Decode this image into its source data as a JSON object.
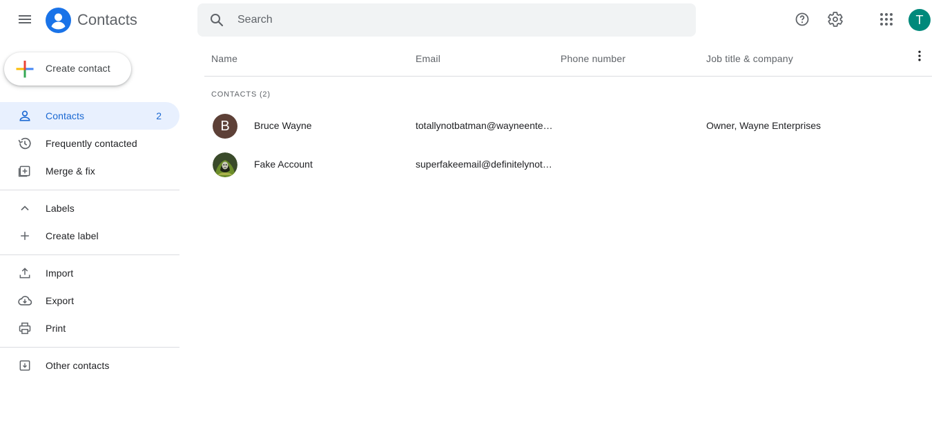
{
  "header": {
    "app_title": "Contacts",
    "search_placeholder": "Search",
    "account_initial": "T",
    "icons": [
      "menu-icon",
      "contacts-logo-icon",
      "search-icon",
      "help-icon",
      "settings-icon",
      "apps-grid-icon"
    ]
  },
  "sidebar": {
    "create_label": "Create contact",
    "items": [
      {
        "label": "Contacts",
        "count": "2",
        "icon": "person-icon",
        "active": true
      },
      {
        "label": "Frequently contacted",
        "icon": "history-icon"
      },
      {
        "label": "Merge & fix",
        "icon": "merge-icon"
      },
      {
        "label": "Labels",
        "icon": "chevron-up-icon"
      },
      {
        "label": "Create label",
        "icon": "plus-icon"
      },
      {
        "label": "Import",
        "icon": "upload-icon"
      },
      {
        "label": "Export",
        "icon": "cloud-download-icon"
      },
      {
        "label": "Print",
        "icon": "printer-icon"
      },
      {
        "label": "Other contacts",
        "icon": "archive-icon"
      }
    ]
  },
  "table": {
    "columns": [
      "Name",
      "Email",
      "Phone number",
      "Job title & company"
    ],
    "section_label": "CONTACTS (2)",
    "rows": [
      {
        "initial": "B",
        "name": "Bruce Wayne",
        "email": "totallynotbatman@wayneenterprises.com",
        "phone": "",
        "job": "Owner, Wayne Enterprises"
      },
      {
        "initial": "",
        "name": "Fake Account",
        "email": "superfakeemail@definitelynotreal.com",
        "phone": "",
        "job": ""
      }
    ]
  },
  "colors": {
    "accent": "#1a73e8",
    "active_bg": "#e8f0fe",
    "avatar_account": "#00897b",
    "avatar_bruce": "#5d4037"
  }
}
